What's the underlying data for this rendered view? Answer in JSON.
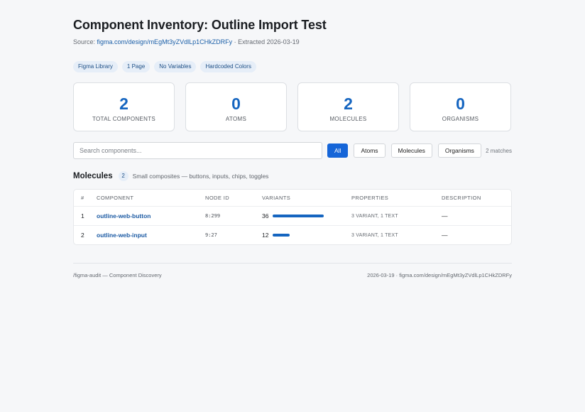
{
  "header": {
    "title": "Component Inventory: Outline Import Test",
    "source_label": "Source: ",
    "source_link": "figma.com/design/mEgMt3yZVdlLp1CHkZDRFy",
    "extracted": " · Extracted 2026-03-19"
  },
  "tags": [
    "Figma Library",
    "1 Page",
    "No Variables",
    "Hardcoded Colors"
  ],
  "stats": [
    {
      "value": "2",
      "label": "TOTAL COMPONENTS"
    },
    {
      "value": "0",
      "label": "ATOMS"
    },
    {
      "value": "2",
      "label": "MOLECULES"
    },
    {
      "value": "0",
      "label": "ORGANISMS"
    }
  ],
  "filters": {
    "search_placeholder": "Search components...",
    "buttons": [
      "All",
      "Atoms",
      "Molecules",
      "Organisms"
    ],
    "active": "All",
    "matches": "2 matches"
  },
  "section": {
    "title": "Molecules",
    "count": "2",
    "description": "Small composites — buttons, inputs, chips, toggles"
  },
  "table": {
    "columns": [
      "#",
      "COMPONENT",
      "NODE ID",
      "VARIANTS",
      "PROPERTIES",
      "DESCRIPTION"
    ],
    "rows": [
      {
        "num": "1",
        "component": "outline-web-button",
        "node_id": "8:299",
        "variants": "36",
        "variant_fraction": 1.0,
        "properties": "3 VARIANT, 1 TEXT",
        "description": "—"
      },
      {
        "num": "2",
        "component": "outline-web-input",
        "node_id": "9:27",
        "variants": "12",
        "variant_fraction": 0.333,
        "properties": "3 VARIANT, 1 TEXT",
        "description": "—"
      }
    ]
  },
  "footer": {
    "left": "/figma-audit — Component Discovery",
    "right": "2026-03-19 · figma.com/design/mEgMt3yZVdlLp1CHkZDRFy"
  },
  "colors": {
    "accent": "#1565c0",
    "active_button": "#1565d8",
    "tag_bg": "#e6eef8"
  }
}
